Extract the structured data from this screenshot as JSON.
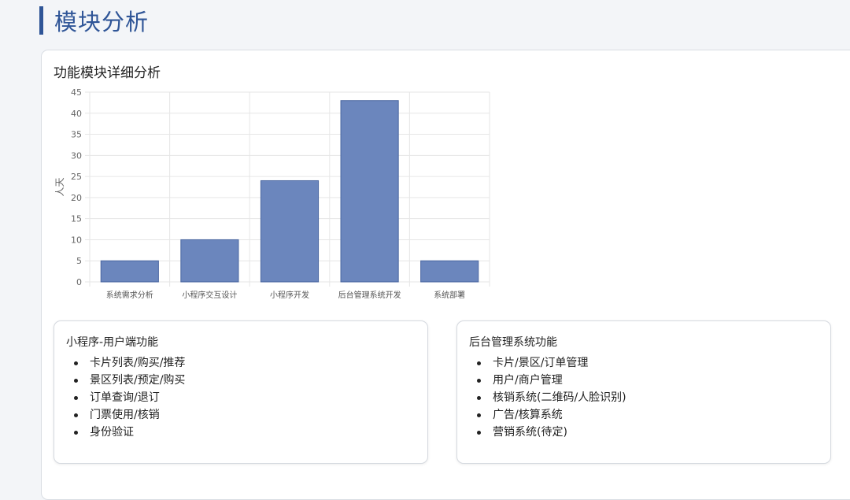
{
  "header": {
    "title": "模块分析"
  },
  "card": {
    "title": "功能模块详细分析"
  },
  "chart_data": {
    "type": "bar",
    "categories": [
      "系统需求分析",
      "小程序交互设计",
      "小程序开发",
      "后台管理系统开发",
      "系统部署"
    ],
    "values": [
      5,
      10,
      24,
      43,
      5
    ],
    "title": "",
    "xlabel": "",
    "ylabel": "人天",
    "ylim": [
      0,
      45
    ],
    "yticks": [
      0,
      5,
      10,
      15,
      20,
      25,
      30,
      35,
      40,
      45
    ],
    "grid": true,
    "bar_color": "#6b86bd",
    "bar_border_color": "#4a66a0"
  },
  "left_box": {
    "title": "小程序-用户端功能",
    "items": [
      "卡片列表/购买/推荐",
      "景区列表/预定/购买",
      "订单查询/退订",
      "门票使用/核销",
      "身份验证"
    ]
  },
  "right_box": {
    "title": "后台管理系统功能",
    "items": [
      "卡片/景区/订单管理",
      "用户/商户管理",
      "核销系统(二维码/人脸识别)",
      "广告/核算系统",
      "营销系统(待定)"
    ]
  },
  "colors": {
    "accent": "#2f5597",
    "background": "#f3f5f8"
  }
}
